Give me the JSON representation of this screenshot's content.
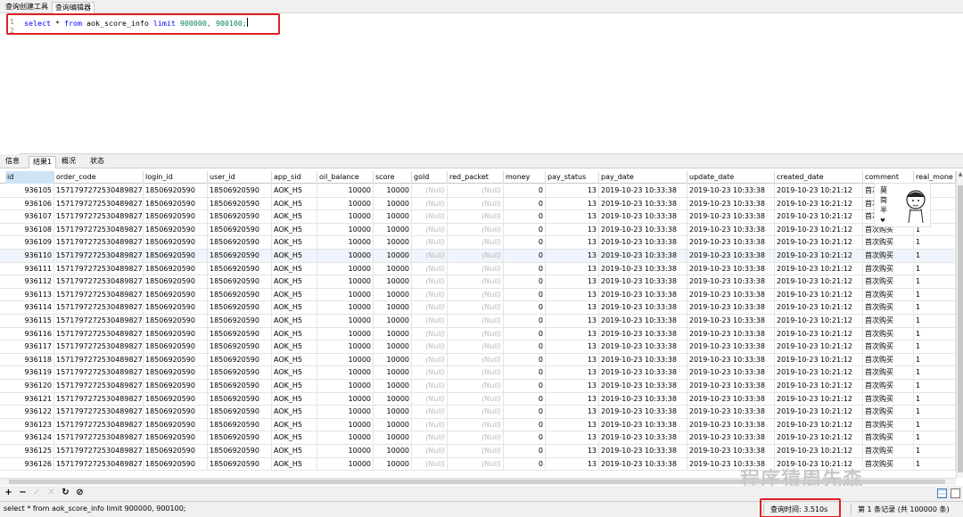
{
  "top_tabs": [
    "查询创建工具",
    "查询编辑器"
  ],
  "editor": {
    "line_numbers": [
      "1",
      "2"
    ],
    "query": {
      "select": "select",
      "star": "*",
      "from": "from",
      "table": "aok_score_info",
      "limit": "limit",
      "offset": "900000,",
      "count": "900100;"
    }
  },
  "result_tabs": [
    "信息",
    "结果1",
    "概况",
    "状态"
  ],
  "columns": [
    "id",
    "order_code",
    "login_id",
    "user_id",
    "app_sid",
    "oil_balance",
    "score",
    "gold",
    "red_packet",
    "money",
    "pay_status",
    "pay_date",
    "update_date",
    "created_date",
    "comment",
    "real_mone"
  ],
  "rows": [
    [
      "936105",
      "1571797272530489827",
      "18506920590",
      "18506920590",
      "AOK_H5",
      "10000",
      "10000",
      "(Null)",
      "(Null)",
      "0",
      "13",
      "2019-10-23 10:33:38",
      "2019-10-23 10:33:38",
      "2019-10-23 10:21:12",
      "首次购买",
      "1"
    ],
    [
      "936106",
      "1571797272530489827",
      "18506920590",
      "18506920590",
      "AOK_H5",
      "10000",
      "10000",
      "(Null)",
      "(Null)",
      "0",
      "13",
      "2019-10-23 10:33:38",
      "2019-10-23 10:33:38",
      "2019-10-23 10:21:12",
      "首次购买",
      "1"
    ],
    [
      "936107",
      "1571797272530489827",
      "18506920590",
      "18506920590",
      "AOK_H5",
      "10000",
      "10000",
      "(Null)",
      "(Null)",
      "0",
      "13",
      "2019-10-23 10:33:38",
      "2019-10-23 10:33:38",
      "2019-10-23 10:21:12",
      "首次购买",
      "1"
    ],
    [
      "936108",
      "1571797272530489827",
      "18506920590",
      "18506920590",
      "AOK_H5",
      "10000",
      "10000",
      "(Null)",
      "(Null)",
      "0",
      "13",
      "2019-10-23 10:33:38",
      "2019-10-23 10:33:38",
      "2019-10-23 10:21:12",
      "首次购买",
      "1"
    ],
    [
      "936109",
      "1571797272530489827",
      "18506920590",
      "18506920590",
      "AOK_H5",
      "10000",
      "10000",
      "(Null)",
      "(Null)",
      "0",
      "13",
      "2019-10-23 10:33:38",
      "2019-10-23 10:33:38",
      "2019-10-23 10:21:12",
      "首次购买",
      "1"
    ],
    [
      "936110",
      "1571797272530489827",
      "18506920590",
      "18506920590",
      "AOK_H5",
      "10000",
      "10000",
      "(Null)",
      "(Null)",
      "0",
      "13",
      "2019-10-23 10:33:38",
      "2019-10-23 10:33:38",
      "2019-10-23 10:21:12",
      "首次购买",
      "1"
    ],
    [
      "936111",
      "1571797272530489827",
      "18506920590",
      "18506920590",
      "AOK_H5",
      "10000",
      "10000",
      "(Null)",
      "(Null)",
      "0",
      "13",
      "2019-10-23 10:33:38",
      "2019-10-23 10:33:38",
      "2019-10-23 10:21:12",
      "首次购买",
      "1"
    ],
    [
      "936112",
      "1571797272530489827",
      "18506920590",
      "18506920590",
      "AOK_H5",
      "10000",
      "10000",
      "(Null)",
      "(Null)",
      "0",
      "13",
      "2019-10-23 10:33:38",
      "2019-10-23 10:33:38",
      "2019-10-23 10:21:12",
      "首次购买",
      "1"
    ],
    [
      "936113",
      "1571797272530489827",
      "18506920590",
      "18506920590",
      "AOK_H5",
      "10000",
      "10000",
      "(Null)",
      "(Null)",
      "0",
      "13",
      "2019-10-23 10:33:38",
      "2019-10-23 10:33:38",
      "2019-10-23 10:21:12",
      "首次购买",
      "1"
    ],
    [
      "936114",
      "1571797272530489827",
      "18506920590",
      "18506920590",
      "AOK_H5",
      "10000",
      "10000",
      "(Null)",
      "(Null)",
      "0",
      "13",
      "2019-10-23 10:33:38",
      "2019-10-23 10:33:38",
      "2019-10-23 10:21:12",
      "首次购买",
      "1"
    ],
    [
      "936115",
      "1571797272530489827",
      "18506920590",
      "18506920590",
      "AOK_H5",
      "10000",
      "10000",
      "(Null)",
      "(Null)",
      "0",
      "13",
      "2019-10-23 10:33:38",
      "2019-10-23 10:33:38",
      "2019-10-23 10:21:12",
      "首次购买",
      "1"
    ],
    [
      "936116",
      "1571797272530489827",
      "18506920590",
      "18506920590",
      "AOK_H5",
      "10000",
      "10000",
      "(Null)",
      "(Null)",
      "0",
      "13",
      "2019-10-23 10:33:38",
      "2019-10-23 10:33:38",
      "2019-10-23 10:21:12",
      "首次购买",
      "1"
    ],
    [
      "936117",
      "1571797272530489827",
      "18506920590",
      "18506920590",
      "AOK_H5",
      "10000",
      "10000",
      "(Null)",
      "(Null)",
      "0",
      "13",
      "2019-10-23 10:33:38",
      "2019-10-23 10:33:38",
      "2019-10-23 10:21:12",
      "首次购买",
      "1"
    ],
    [
      "936118",
      "1571797272530489827",
      "18506920590",
      "18506920590",
      "AOK_H5",
      "10000",
      "10000",
      "(Null)",
      "(Null)",
      "0",
      "13",
      "2019-10-23 10:33:38",
      "2019-10-23 10:33:38",
      "2019-10-23 10:21:12",
      "首次购买",
      "1"
    ],
    [
      "936119",
      "1571797272530489827",
      "18506920590",
      "18506920590",
      "AOK_H5",
      "10000",
      "10000",
      "(Null)",
      "(Null)",
      "0",
      "13",
      "2019-10-23 10:33:38",
      "2019-10-23 10:33:38",
      "2019-10-23 10:21:12",
      "首次购买",
      "1"
    ],
    [
      "936120",
      "1571797272530489827",
      "18506920590",
      "18506920590",
      "AOK_H5",
      "10000",
      "10000",
      "(Null)",
      "(Null)",
      "0",
      "13",
      "2019-10-23 10:33:38",
      "2019-10-23 10:33:38",
      "2019-10-23 10:21:12",
      "首次购买",
      "1"
    ],
    [
      "936121",
      "1571797272530489827",
      "18506920590",
      "18506920590",
      "AOK_H5",
      "10000",
      "10000",
      "(Null)",
      "(Null)",
      "0",
      "13",
      "2019-10-23 10:33:38",
      "2019-10-23 10:33:38",
      "2019-10-23 10:21:12",
      "首次购买",
      "1"
    ],
    [
      "936122",
      "1571797272530489827",
      "18506920590",
      "18506920590",
      "AOK_H5",
      "10000",
      "10000",
      "(Null)",
      "(Null)",
      "0",
      "13",
      "2019-10-23 10:33:38",
      "2019-10-23 10:33:38",
      "2019-10-23 10:21:12",
      "首次购买",
      "1"
    ],
    [
      "936123",
      "1571797272530489827",
      "18506920590",
      "18506920590",
      "AOK_H5",
      "10000",
      "10000",
      "(Null)",
      "(Null)",
      "0",
      "13",
      "2019-10-23 10:33:38",
      "2019-10-23 10:33:38",
      "2019-10-23 10:21:12",
      "首次购买",
      "1"
    ],
    [
      "936124",
      "1571797272530489827",
      "18506920590",
      "18506920590",
      "AOK_H5",
      "10000",
      "10000",
      "(Null)",
      "(Null)",
      "0",
      "13",
      "2019-10-23 10:33:38",
      "2019-10-23 10:33:38",
      "2019-10-23 10:21:12",
      "首次购买",
      "1"
    ],
    [
      "936125",
      "1571797272530489827",
      "18506920590",
      "18506920590",
      "AOK_H5",
      "10000",
      "10000",
      "(Null)",
      "(Null)",
      "0",
      "13",
      "2019-10-23 10:33:38",
      "2019-10-23 10:33:38",
      "2019-10-23 10:21:12",
      "首次购买",
      "1"
    ],
    [
      "936126",
      "1571797272530489827",
      "18506920590",
      "18506920590",
      "AOK_H5",
      "10000",
      "10000",
      "(Null)",
      "(Null)",
      "0",
      "13",
      "2019-10-23 10:33:38",
      "2019-10-23 10:33:38",
      "2019-10-23 10:21:12",
      "首次购买",
      "1"
    ]
  ],
  "toolbar": {
    "icons": [
      "plus-icon",
      "minus-icon",
      "check-icon",
      "cross-icon",
      "refresh-icon",
      "stop-icon"
    ],
    "glyphs": [
      "+",
      "−",
      "✓",
      "✕",
      "↻",
      "⊘"
    ]
  },
  "status": {
    "sql": "select * from aok_score_info limit 900000, 900100;",
    "query_time": "查询时间: 3.510s",
    "record_info": "第 1 条记录 (共 100000 条)"
  },
  "sticker": {
    "text": "莫简半"
  },
  "watermark": "程序猿周先森",
  "colors": {
    "highlight_red": "#e02020",
    "keyword_blue": "#0000ff",
    "number_green": "#098658",
    "selected_row_blue": "#eef5fd"
  }
}
